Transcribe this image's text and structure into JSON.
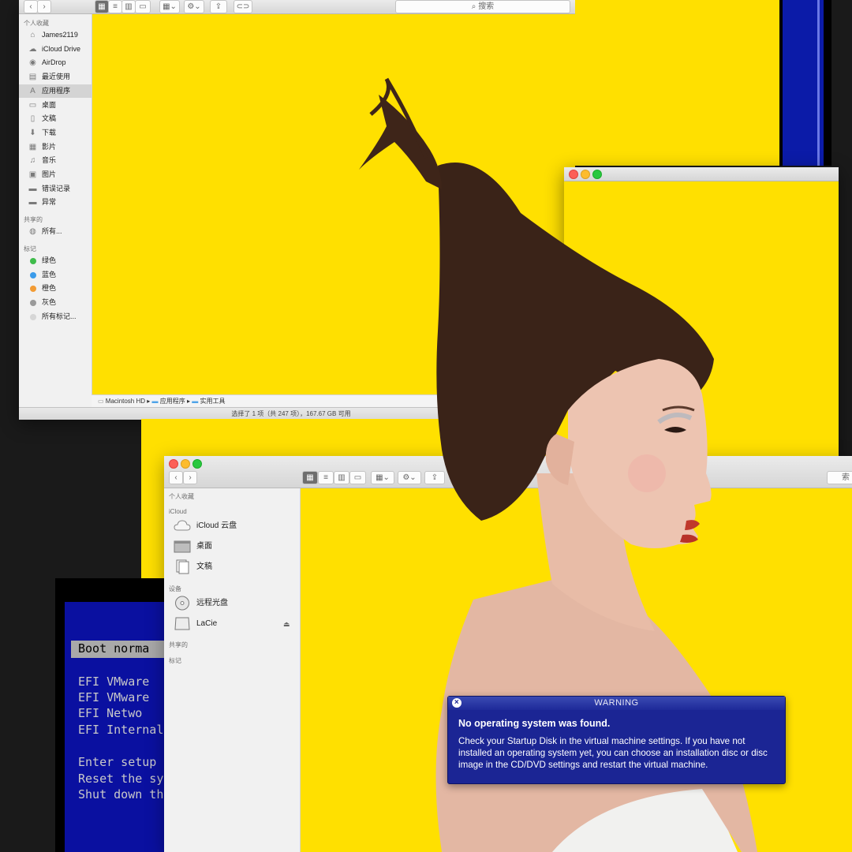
{
  "finder_top": {
    "search_placeholder": "搜索",
    "sidebar": {
      "favorites_header": "个人收藏",
      "favorites": [
        {
          "label": "James2119",
          "icon": "home-icon"
        },
        {
          "label": "iCloud Drive",
          "icon": "cloud-icon"
        },
        {
          "label": "AirDrop",
          "icon": "airdrop-icon"
        },
        {
          "label": "最近使用",
          "icon": "recent-icon"
        },
        {
          "label": "应用程序",
          "icon": "applications-icon"
        },
        {
          "label": "桌面",
          "icon": "desktop-icon"
        },
        {
          "label": "文稿",
          "icon": "documents-icon"
        },
        {
          "label": "下载",
          "icon": "download-icon"
        },
        {
          "label": "影片",
          "icon": "movies-icon"
        },
        {
          "label": "音乐",
          "icon": "music-icon"
        },
        {
          "label": "图片",
          "icon": "pictures-icon"
        },
        {
          "label": "错误记录",
          "icon": "folder-icon"
        },
        {
          "label": "异常",
          "icon": "folder-icon"
        }
      ],
      "shared_header": "共享的",
      "shared": [
        {
          "label": "所有...",
          "icon": "network-icon"
        }
      ],
      "tags_header": "标记",
      "tags": [
        {
          "label": "绿色",
          "color": "#3fbc4b"
        },
        {
          "label": "蓝色",
          "color": "#3b9bea"
        },
        {
          "label": "橙色",
          "color": "#f29b34"
        },
        {
          "label": "灰色",
          "color": "#9a9a9a"
        },
        {
          "label": "所有标记...",
          "color": "#d6d6d6"
        }
      ]
    },
    "path": [
      "Macintosh HD",
      "应用程序",
      "实用工具"
    ],
    "status": "选择了 1 项（共 247 项），167.67 GB 可用"
  },
  "finder_bottom": {
    "sidebar": {
      "favorites_header": "个人收藏",
      "icloud_header": "iCloud",
      "icloud": [
        {
          "label": "iCloud 云盘",
          "icon": "cloud-icon"
        },
        {
          "label": "桌面",
          "icon": "desktop-icon"
        },
        {
          "label": "文稿",
          "icon": "documents-icon"
        }
      ],
      "devices_header": "设备",
      "devices": [
        {
          "label": "远程光盘",
          "icon": "optical-disc-icon"
        },
        {
          "label": "LaCie",
          "icon": "hard-drive-icon"
        }
      ],
      "shared_header": "共享的",
      "tags_header": "标记"
    },
    "search_fragment": "索"
  },
  "dos": {
    "selected": "Boot norma",
    "lines": [
      "EFI VMware",
      "EFI VMware",
      "EFI Netwo",
      "EFI Internal"
    ],
    "lines2": [
      "Enter setup",
      "Reset the sys",
      "Shut down the"
    ]
  },
  "warning": {
    "title": "WARNING",
    "heading": "No operating system was found.",
    "body": "Check your Startup Disk in the virtual machine settings. If you have not installed an operating system yet, you can choose an installation disc or disc image in the CD/DVD settings and restart the virtual machine."
  },
  "colors": {
    "yellow": "#ffe000",
    "warning_blue": "#1b2594",
    "dos_blue": "#0a10a0"
  }
}
